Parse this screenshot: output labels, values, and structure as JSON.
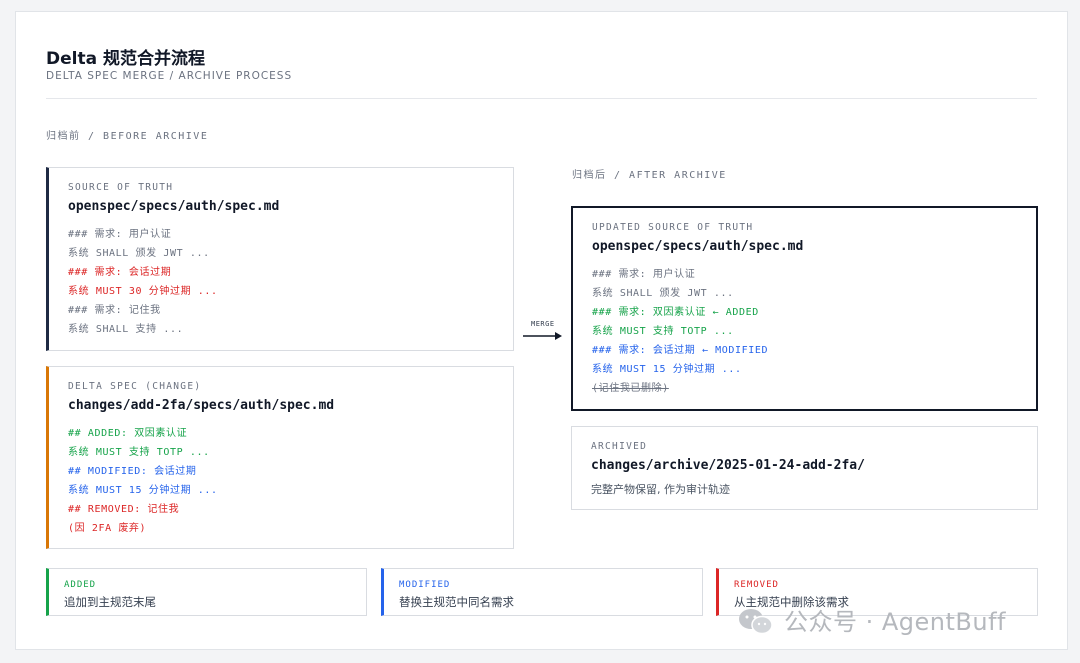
{
  "header": {
    "title": "Delta 规范合并流程",
    "subtitle": "DELTA SPEC MERGE / ARCHIVE PROCESS"
  },
  "before": {
    "label": "归档前 / BEFORE ARCHIVE",
    "source": {
      "caption": "SOURCE OF TRUTH",
      "path": "openspec/specs/auth/spec.md",
      "lines": [
        "### 需求: 用户认证",
        "系统 SHALL 颁发 JWT ...",
        "### 需求: 会话过期",
        "系统 MUST 30 分钟过期 ...",
        "### 需求: 记住我",
        "系统 SHALL 支持 ..."
      ]
    },
    "delta": {
      "caption": "DELTA SPEC (CHANGE)",
      "path": "changes/add-2fa/specs/auth/spec.md",
      "lines": [
        "## ADDED: 双因素认证",
        "系统 MUST 支持 TOTP ...",
        "## MODIFIED: 会话过期",
        "系统 MUST 15 分钟过期 ...",
        "## REMOVED: 记住我",
        "(因 2FA 废弃)"
      ]
    }
  },
  "merge_label": "MERGE",
  "after": {
    "label": "归档后 / AFTER ARCHIVE",
    "updated": {
      "caption": "UPDATED SOURCE OF TRUTH",
      "path": "openspec/specs/auth/spec.md",
      "lines": [
        "### 需求: 用户认证",
        "系统 SHALL 颁发 JWT ...",
        "### 需求: 双因素认证 ← ADDED",
        "系统 MUST 支持 TOTP ...",
        "### 需求: 会话过期 ← MODIFIED",
        "系统 MUST 15 分钟过期 ...",
        "(记住我已删除)"
      ]
    },
    "archived": {
      "caption": "ARCHIVED",
      "path": "changes/archive/2025-01-24-add-2fa/",
      "desc": "完整产物保留, 作为审计轨迹"
    }
  },
  "legend": [
    {
      "tag": "ADDED",
      "desc": "追加到主规范末尾",
      "color": "#16a34a"
    },
    {
      "tag": "MODIFIED",
      "desc": "替换主规范中同名需求",
      "color": "#2563eb"
    },
    {
      "tag": "REMOVED",
      "desc": "从主规范中删除该需求",
      "color": "#dc2626"
    }
  ],
  "watermark": "公众号 · AgentBuff",
  "colors": {
    "source_accent": "#1f2a44",
    "delta_accent": "#d97706",
    "added": "#16a34a",
    "modified": "#2563eb",
    "removed": "#dc2626"
  }
}
